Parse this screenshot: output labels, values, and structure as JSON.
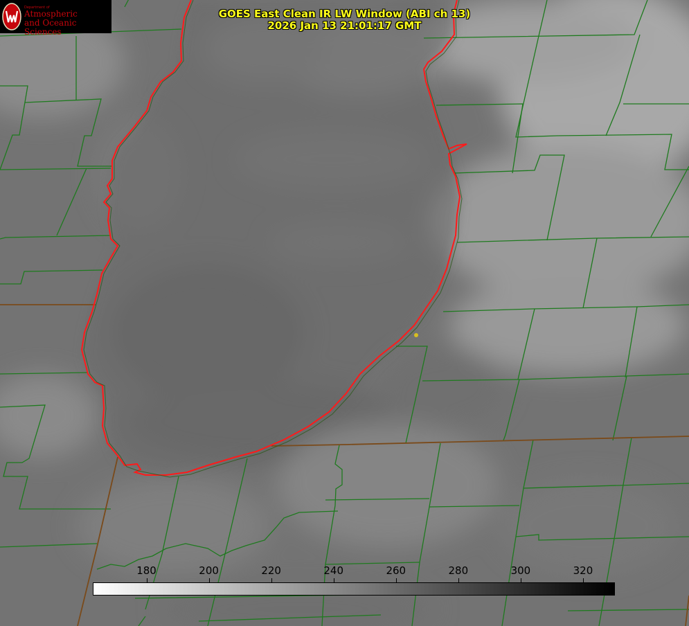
{
  "logo": {
    "department": "Department of",
    "line1": "Atmospheric",
    "line2": "and Oceanic Sciences",
    "color": "#c5050c"
  },
  "title": {
    "line1": "GOES East Clean IR LW Window (ABI ch 13)",
    "line2": "2026 Jan 13 21:01:17 GMT",
    "color": "#ffff1a"
  },
  "colorbar": {
    "ticks": [
      "180",
      "200",
      "220",
      "240",
      "260",
      "280",
      "300",
      "320"
    ],
    "min": 163,
    "max": 330,
    "low_color": "#ffffff",
    "high_color": "#000000"
  },
  "map_colors": {
    "county_lines": "#1e7a1e",
    "state_lines": "#7a4a1a",
    "shoreline": "#ff1a1a",
    "marker": "#d8c020"
  }
}
